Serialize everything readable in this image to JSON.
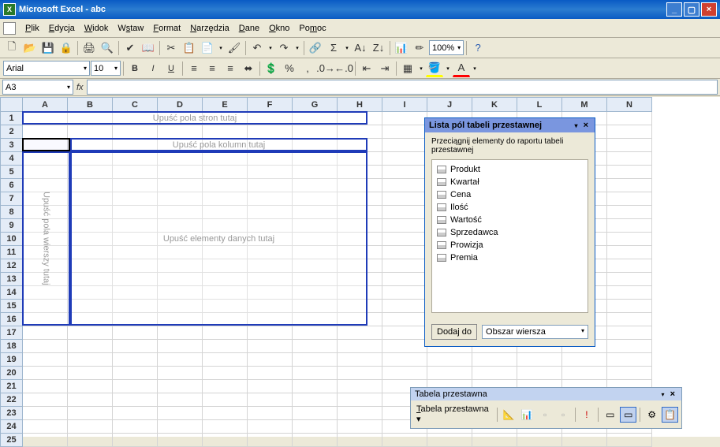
{
  "titlebar": {
    "app": "Microsoft Excel",
    "doc": "abc"
  },
  "menu": [
    "Plik",
    "Edycja",
    "Widok",
    "Wstaw",
    "Format",
    "Narzędzia",
    "Dane",
    "Okno",
    "Pomoc"
  ],
  "toolbar1": {
    "zoom": "100%"
  },
  "toolbar2": {
    "font": "Arial",
    "size": "10"
  },
  "namebox": "A3",
  "columns": [
    "A",
    "B",
    "C",
    "D",
    "E",
    "F",
    "G",
    "H",
    "I",
    "J",
    "K",
    "L",
    "M",
    "N"
  ],
  "rows": [
    1,
    2,
    3,
    4,
    5,
    6,
    7,
    8,
    9,
    10,
    11,
    12,
    13,
    14,
    15,
    16,
    17,
    18,
    19,
    20,
    21,
    22,
    23,
    24,
    25
  ],
  "pivot": {
    "page_hint": "Upuść pola stron tutaj",
    "col_hint": "Upuść pola kolumn tutaj",
    "row_hint": "Upuść pola wierszy tutaj",
    "data_hint": "Upuść elementy danych tutaj"
  },
  "fieldlist": {
    "title": "Lista pól tabeli przestawnej",
    "instruction": "Przeciągnij elementy do raportu tabeli przestawnej",
    "fields": [
      "Produkt",
      "Kwartał",
      "Cena",
      "Ilość",
      "Wartość",
      "Sprzedawca",
      "Prowizja",
      "Premia"
    ],
    "add_label": "Dodaj do",
    "area": "Obszar wiersza"
  },
  "pivottb": {
    "title": "Tabela przestawna",
    "menu_label": "Tabela przestawna"
  }
}
